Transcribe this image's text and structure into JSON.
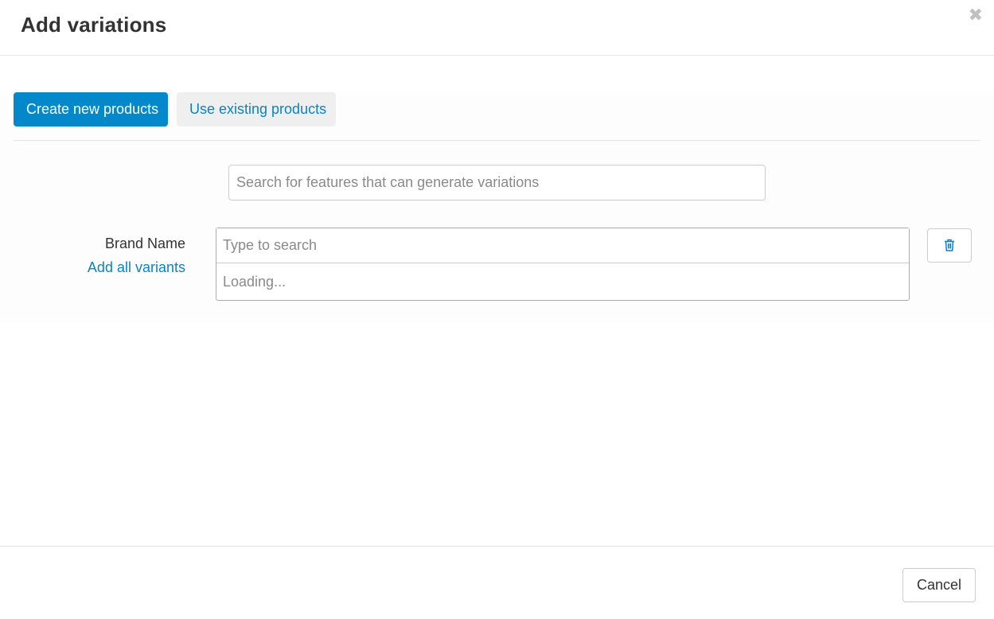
{
  "dialog": {
    "title": "Add variations",
    "close_icon": "close-icon"
  },
  "tabs": [
    {
      "label": "Create new products",
      "active": true
    },
    {
      "label": "Use existing products",
      "active": false
    }
  ],
  "feature_search": {
    "placeholder": "Search for features that can generate variations",
    "value": ""
  },
  "feature_row": {
    "label": "Brand Name",
    "add_all_label": "Add all variants",
    "search_placeholder": "Type to search",
    "search_value": "",
    "loading_text": "Loading...",
    "delete_icon": "trash-icon"
  },
  "footer": {
    "cancel_label": "Cancel"
  },
  "colors": {
    "primary": "#0388cc",
    "link": "#0b83c4",
    "inactive_tab_bg": "#efefef"
  }
}
